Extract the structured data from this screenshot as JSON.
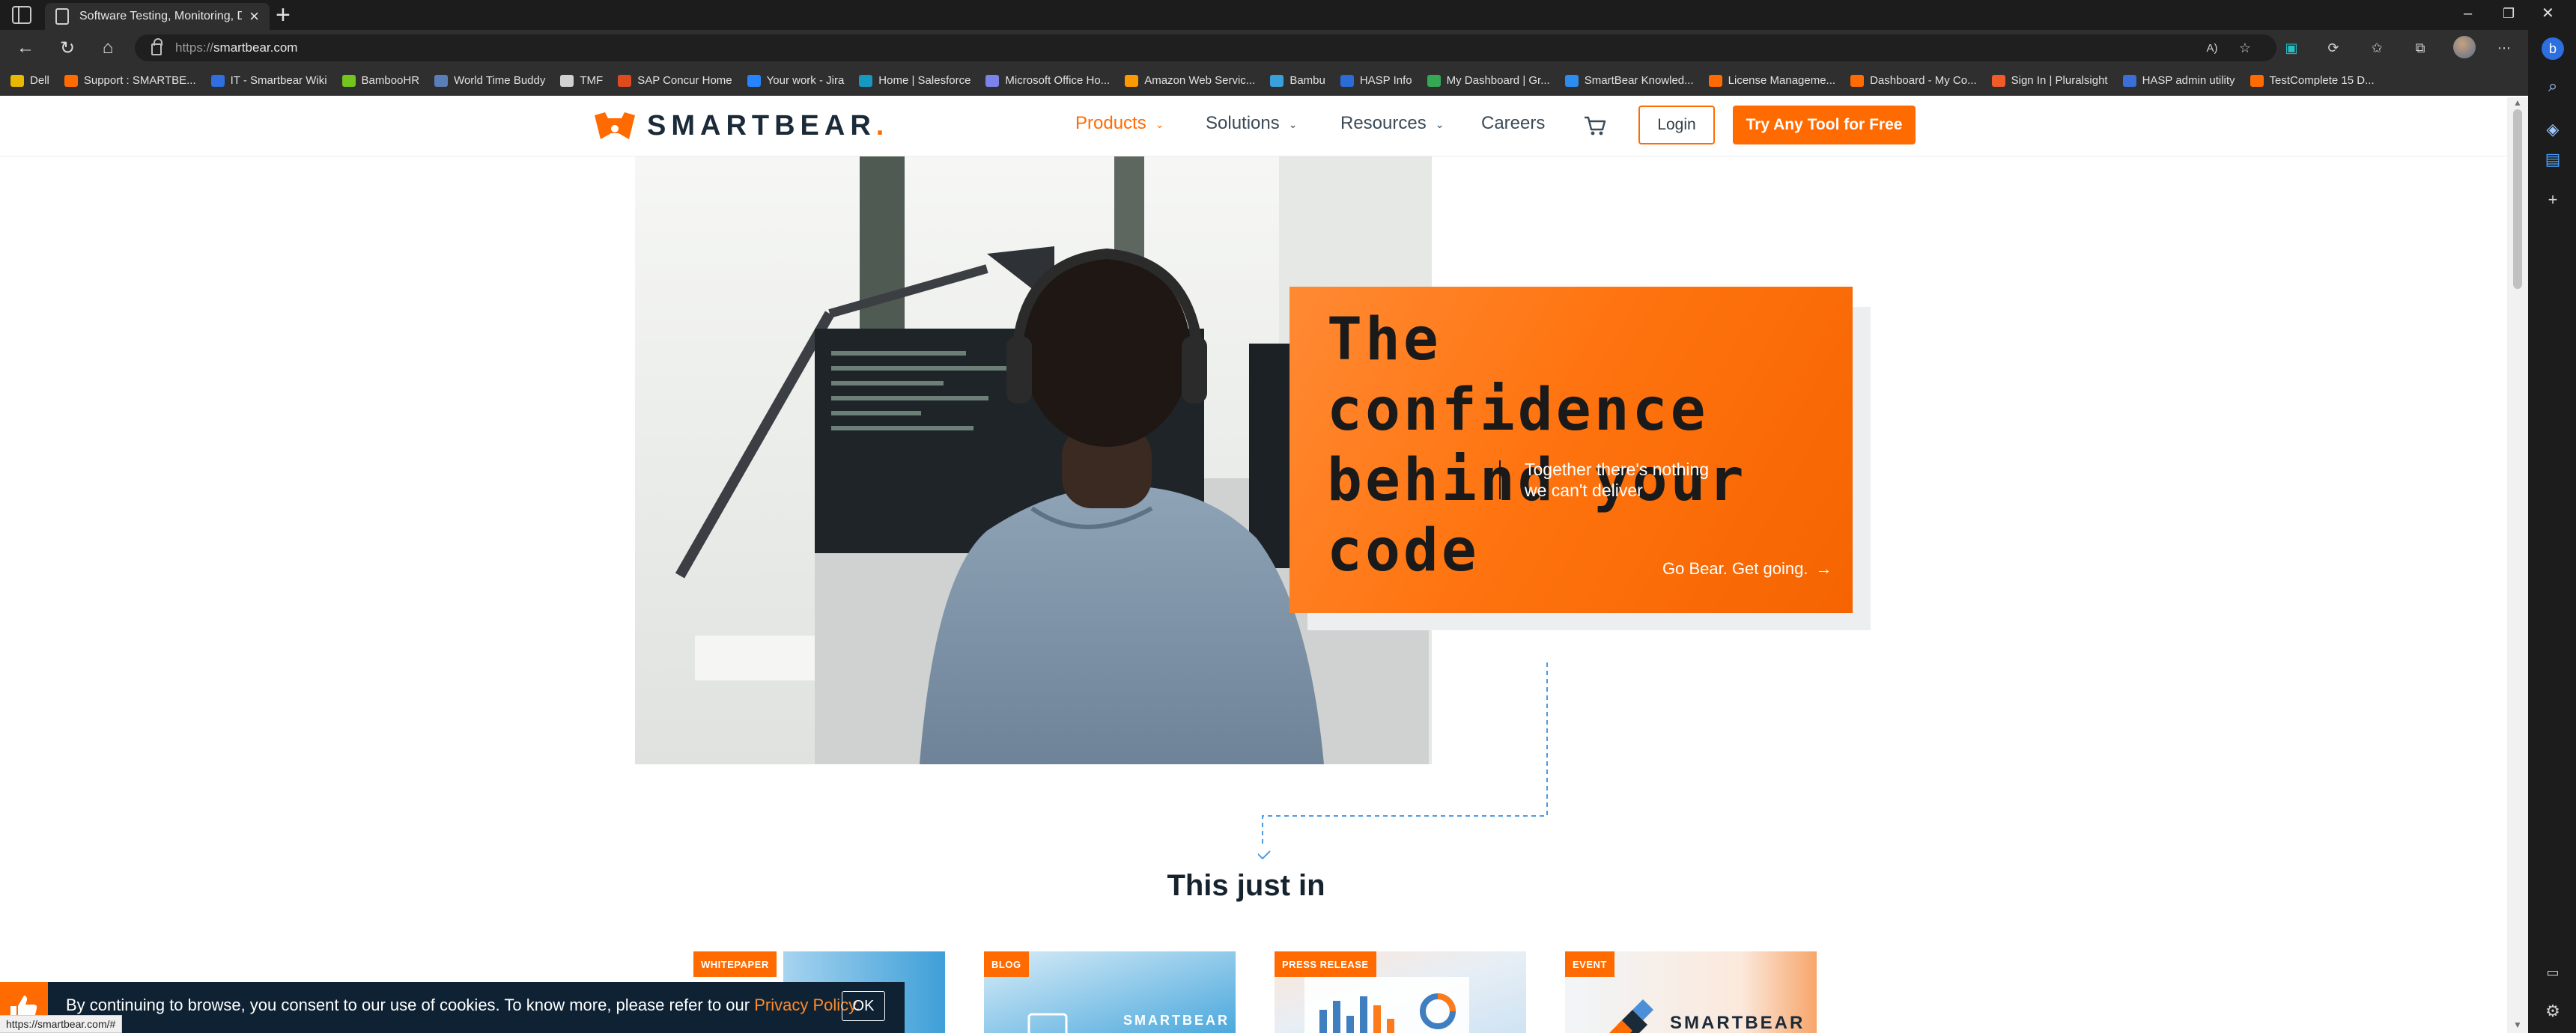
{
  "browser": {
    "tab_title": "Software Testing, Monitoring, De",
    "url_scheme": "https://",
    "url_host": "smartbear.com",
    "status_url": "https://smartbear.com/#",
    "bookmarks": [
      {
        "label": "Dell",
        "color": "#e8b900"
      },
      {
        "label": "Support : SMARTBE...",
        "color": "#ff6b00"
      },
      {
        "label": "IT - Smartbear Wiki",
        "color": "#2f6fe0"
      },
      {
        "label": "BambooHR",
        "color": "#73c41d"
      },
      {
        "label": "World Time Buddy",
        "color": "#5a7fb8"
      },
      {
        "label": "TMF",
        "color": "#d0d0d0"
      },
      {
        "label": "SAP Concur Home",
        "color": "#e04a1f"
      },
      {
        "label": "Your work - Jira",
        "color": "#2684ff"
      },
      {
        "label": "Home | Salesforce",
        "color": "#1798c1"
      },
      {
        "label": "Microsoft Office Ho...",
        "color": "#7b83eb"
      },
      {
        "label": "Amazon Web Servic...",
        "color": "#ff9900"
      },
      {
        "label": "Bambu",
        "color": "#39a0d9"
      },
      {
        "label": "HASP Info",
        "color": "#2b6cd8"
      },
      {
        "label": "My Dashboard | Gr...",
        "color": "#34a853"
      },
      {
        "label": "SmartBear Knowled...",
        "color": "#2d8cf0"
      },
      {
        "label": "License Manageme...",
        "color": "#ff6b00"
      },
      {
        "label": "Dashboard - My Co...",
        "color": "#ff6b00"
      },
      {
        "label": "Sign In | Pluralsight",
        "color": "#f15b2a"
      },
      {
        "label": "HASP admin utility",
        "color": "#3b6fd6"
      },
      {
        "label": "TestComplete 15 D...",
        "color": "#ff6b00"
      }
    ]
  },
  "site": {
    "logo_text": "SMARTBEAR",
    "nav": {
      "products": "Products",
      "solutions": "Solutions",
      "resources": "Resources",
      "careers": "Careers"
    },
    "login_label": "Login",
    "try_label": "Try Any Tool for Free",
    "accent_color": "#ff6b00"
  },
  "hero": {
    "headline_line1": "The confidence",
    "headline_line2": "behind your",
    "headline_line3": "code",
    "subtitle_line1": "Together there's nothing",
    "subtitle_line2": "we can't deliver",
    "cta": "Go Bear. Get going."
  },
  "news": {
    "title": "This just in",
    "cards": [
      {
        "badge": "WHITEPAPER"
      },
      {
        "badge": "BLOG",
        "image_text": "SMARTBEAR"
      },
      {
        "badge": "PRESS RELEASE"
      },
      {
        "badge": "EVENT",
        "image_text": "SMARTBEAR"
      }
    ]
  },
  "cookie": {
    "text": "By continuing to browse, you consent to our use of cookies. To know more, please refer to our ",
    "link": "Privacy Policy",
    "end": ".",
    "ok": "OK"
  }
}
